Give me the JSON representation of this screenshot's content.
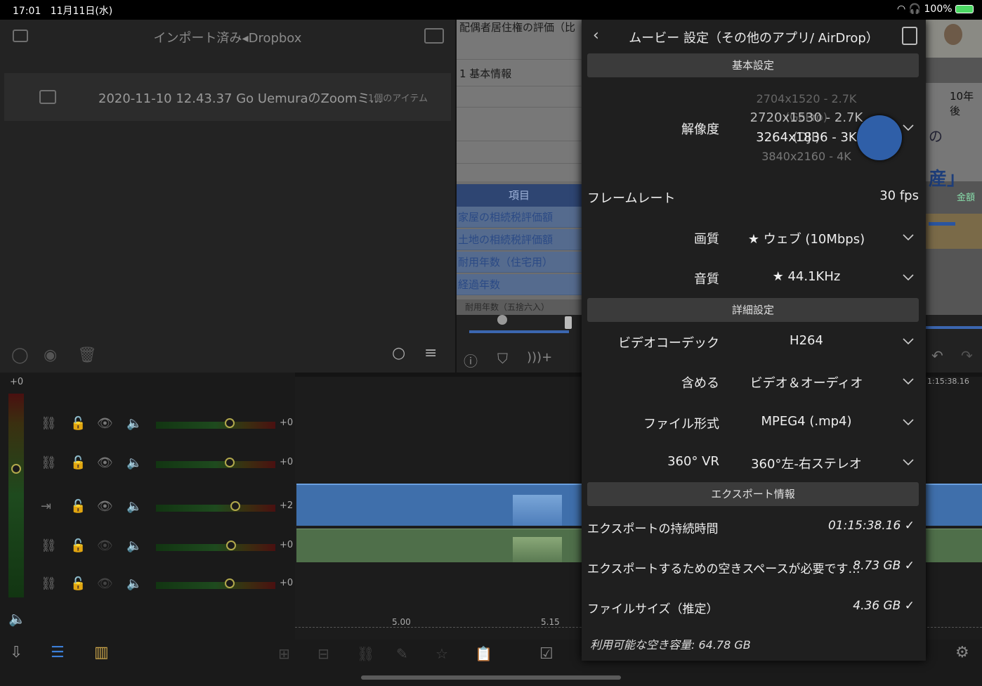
{
  "status": {
    "time": "17:01",
    "date": "11月11日(水)",
    "battery": "100%"
  },
  "browser": {
    "title": "インポート済み◂Dropbox",
    "file": {
      "name": "2020-11-10 12.43.37 Go UemuraのZoomミ…",
      "count": "1個のアイテム"
    }
  },
  "preview": {
    "heading": "配偶者居住権の評価（比",
    "section": "1 基本情報",
    "table_header": "項目",
    "rows": [
      "家屋の相続税評価額",
      "土地の相続税評価額",
      "耐用年数（住宅用）",
      "経過年数"
    ],
    "sub": "耐用年数（五捨六入）"
  },
  "right_strip": {
    "label1": "10年後",
    "label2": "の",
    "label3": "産」",
    "label4": "金額",
    "timecode": "1:15:38.16"
  },
  "tracks": {
    "master_db": "+0",
    "rows": [
      {
        "db": "+0"
      },
      {
        "db": "+0"
      },
      {
        "db": "+2"
      },
      {
        "db": "+0"
      },
      {
        "db": "+0"
      }
    ]
  },
  "timeline": {
    "ticks": [
      "5.00",
      "5.15"
    ]
  },
  "modal": {
    "title": "ムービー 設定（その他のアプリ/ AirDrop）",
    "sections": {
      "basic": "基本設定",
      "detail": "詳細設定",
      "export": "エクスポート情報"
    },
    "resolution": {
      "label": "解像度",
      "options": [
        "2704x1520 - 2.7K (GoPro)",
        "2720x1530 - 2.7K (DJI)",
        "3264x1836 - 3K",
        "3840x2160 - 4K"
      ]
    },
    "framerate": {
      "label": "フレームレート",
      "value": "30 fps"
    },
    "quality": {
      "label": "画質",
      "value": "★ ウェブ (10Mbps)"
    },
    "audio": {
      "label": "音質",
      "value": "★ 44.1KHz"
    },
    "codec": {
      "label": "ビデオコーデック",
      "value": "H264"
    },
    "include": {
      "label": "含める",
      "value": "ビデオ＆オーディオ"
    },
    "format": {
      "label": "ファイル形式",
      "value": "MPEG4 (.mp4)"
    },
    "vr": {
      "label": "360° VR",
      "value": "360°左-右ステレオ"
    },
    "duration": {
      "label": "エクスポートの持続時間",
      "value": "01:15:38.16 ✓"
    },
    "space_needed": {
      "label": "エクスポートするための空きスペースが必要です…",
      "value": "8.73 GB ✓"
    },
    "filesize": {
      "label": "ファイルサイズ（推定）",
      "value": "4.36 GB ✓"
    },
    "available": "利用可能な空き容量: 64.78 GB"
  },
  "colors": {
    "accent": "#2f5fa8",
    "audio_wave": "#4f6f4a",
    "video_wave": "#3f6fab",
    "knob": "#b2a94c"
  }
}
